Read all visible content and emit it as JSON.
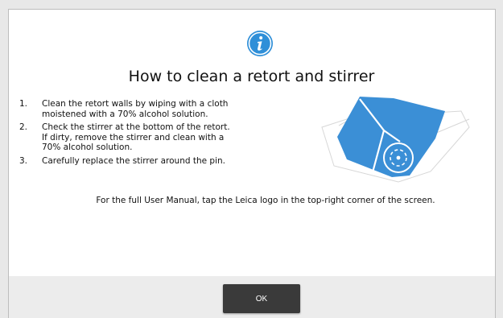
{
  "dialog": {
    "icon": "info-icon",
    "title": "How to clean a retort and stirrer",
    "steps": [
      {
        "number": "1.",
        "lines": [
          "Clean the retort walls by wiping with a cloth",
          "moistened with a 70% alcohol solution."
        ]
      },
      {
        "number": "2.",
        "lines": [
          "Check the stirrer at the bottom of the retort.",
          "If dirty, remove the stirrer and clean with a",
          "70% alcohol solution."
        ]
      },
      {
        "number": "3.",
        "lines": [
          "Carefully replace the stirrer around the pin."
        ]
      }
    ],
    "manual_note": "For the full User Manual, tap the Leica logo in the top-right corner of the screen.",
    "ok_label": "OK"
  },
  "colors": {
    "accent": "#2f8fd8",
    "illustration": "#3b8fd6",
    "button": "#3a3a3a",
    "footer": "#ececec"
  }
}
